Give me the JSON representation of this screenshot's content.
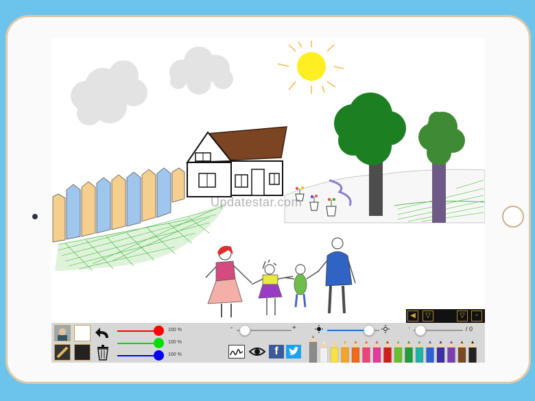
{
  "watermark": "Updatestar.com",
  "toolbar": {
    "rgb": [
      {
        "name": "red",
        "color": "#ff0000",
        "value": 100,
        "label": "100 %"
      },
      {
        "name": "green",
        "color": "#00dd00",
        "value": 100,
        "label": "100 %"
      },
      {
        "name": "blue",
        "color": "#0000ff",
        "value": 100,
        "label": "100 %"
      }
    ],
    "size_minus": "-",
    "size_plus": "+",
    "size_level": 0.15,
    "brightness_level": 0.95,
    "opacity_dot": "·",
    "opacity_level": 0.2,
    "counter": "/ 0",
    "pencil_colors": [
      "#8a8a8a",
      "#f0f0f0",
      "#f6e14a",
      "#f3a52a",
      "#ee6a1c",
      "#e8467a",
      "#e23a9a",
      "#d21b1b",
      "#6bbf2e",
      "#1f9a3c",
      "#1fb3a7",
      "#2c62d6",
      "#3f2fa3",
      "#7b3fb0",
      "#7a4a22",
      "#222222"
    ],
    "icons": [
      "portrait-icon",
      "white-color-icon",
      "undo-icon",
      "pencil-tool-icon",
      "black-color-icon",
      "trash-icon",
      "signature-icon",
      "eye-icon",
      "facebook-icon",
      "twitter-icon",
      "sun-low-icon",
      "sun-high-icon"
    ]
  },
  "nav": [
    "left-arrow-icon",
    "down-arrow-icon",
    "down-arrow-icon",
    "square-icon"
  ]
}
